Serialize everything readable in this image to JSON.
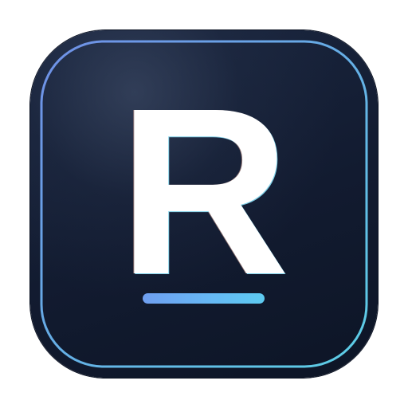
{
  "icon": {
    "letter": "R",
    "colors": {
      "background_top": "#1b2740",
      "background_bottom": "#0d1526",
      "border_start": "#6f8fe6",
      "border_end": "#5ccfe6",
      "letter": "#ffffff",
      "underline_start": "#6f9ff0",
      "underline_end": "#5dcaf0"
    }
  }
}
